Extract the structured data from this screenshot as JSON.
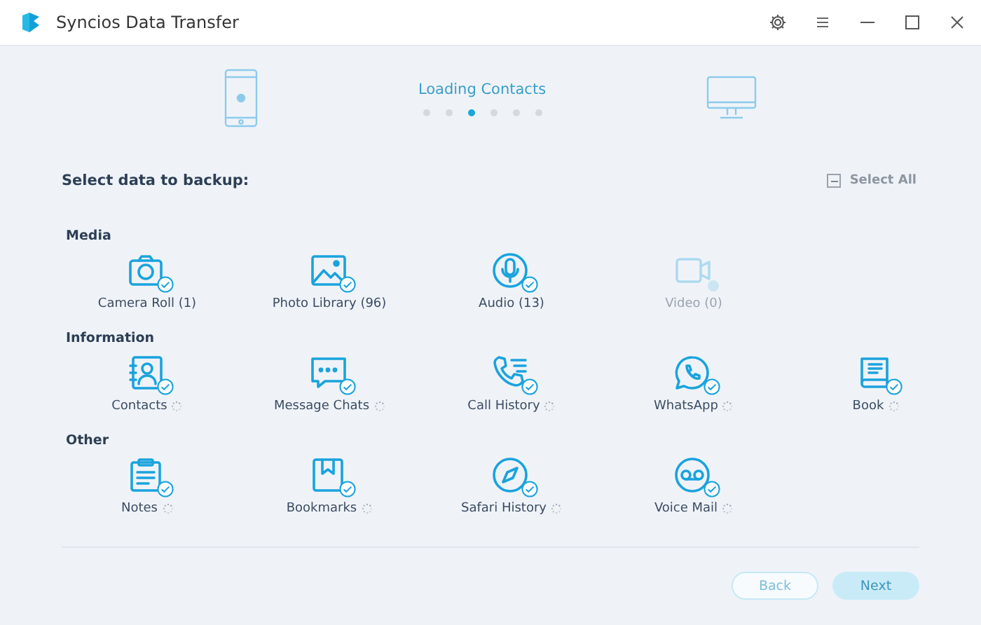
{
  "window": {
    "title": "Syncios Data Transfer"
  },
  "progress": {
    "status": "Loading Contacts",
    "steps": [
      {
        "selected": false
      },
      {
        "selected": false
      },
      {
        "selected": true
      },
      {
        "selected": false
      },
      {
        "selected": false
      },
      {
        "selected": false
      }
    ]
  },
  "heading": "Select data to backup:",
  "select_all": {
    "label": "Select All",
    "checked": false,
    "disabled": true
  },
  "categories": [
    {
      "title": "Media",
      "items": [
        {
          "label": "Camera Roll (1)",
          "checked": true,
          "loading": false,
          "disabled": false
        },
        {
          "label": "Photo Library (96)",
          "checked": true,
          "loading": false,
          "disabled": false
        },
        {
          "label": "Audio (13)",
          "checked": true,
          "loading": false,
          "disabled": false
        },
        {
          "label": "Video (0)",
          "checked": false,
          "loading": false,
          "disabled": true
        }
      ]
    },
    {
      "title": "Information",
      "items": [
        {
          "label": "Contacts",
          "checked": true,
          "loading": true,
          "disabled": false
        },
        {
          "label": "Message Chats",
          "checked": true,
          "loading": true,
          "disabled": false
        },
        {
          "label": "Call History",
          "checked": true,
          "loading": true,
          "disabled": false
        },
        {
          "label": "WhatsApp",
          "checked": true,
          "loading": true,
          "disabled": false
        },
        {
          "label": "Book",
          "checked": true,
          "loading": true,
          "disabled": false
        }
      ]
    },
    {
      "title": "Other",
      "items": [
        {
          "label": "Notes",
          "checked": true,
          "loading": true,
          "disabled": false
        },
        {
          "label": "Bookmarks",
          "checked": true,
          "loading": true,
          "disabled": false
        },
        {
          "label": "Safari History",
          "checked": true,
          "loading": true,
          "disabled": false
        },
        {
          "label": "Voice Mail",
          "checked": true,
          "loading": true,
          "disabled": false
        }
      ]
    }
  ],
  "buttons": [
    {
      "label": "Back",
      "kind": "outline",
      "disabled": true
    },
    {
      "label": "Next",
      "kind": "filled",
      "disabled": true
    }
  ]
}
